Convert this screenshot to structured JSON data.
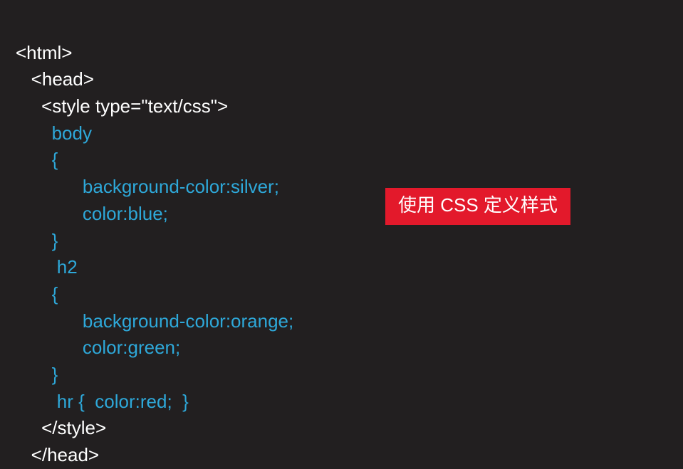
{
  "code": {
    "line1_tag": "<html>",
    "line2_tag": "<head>",
    "line3_before": "<style ",
    "line3_attr_name": "type",
    "line3_eq": "=",
    "line3_attr_val": "\"text/css\"",
    "line3_after": ">",
    "line4_selector": "body",
    "line5_brace": "{",
    "line6_rule": "background-color:silver;",
    "line7_rule": "color:blue;",
    "line8_brace": "}",
    "line9_selector": "h2",
    "line10_brace": "{",
    "line11_rule": "background-color:orange;",
    "line12_rule": "color:green;",
    "line13_brace": "}",
    "line14_sel": "hr",
    "line14_brace_open": " {  ",
    "line14_rule": "color:red;",
    "line14_brace_close": "  }",
    "line15_tag": "</style>",
    "line16_tag": "</head>"
  },
  "annotation": {
    "label": "使用 CSS 定义样式"
  }
}
